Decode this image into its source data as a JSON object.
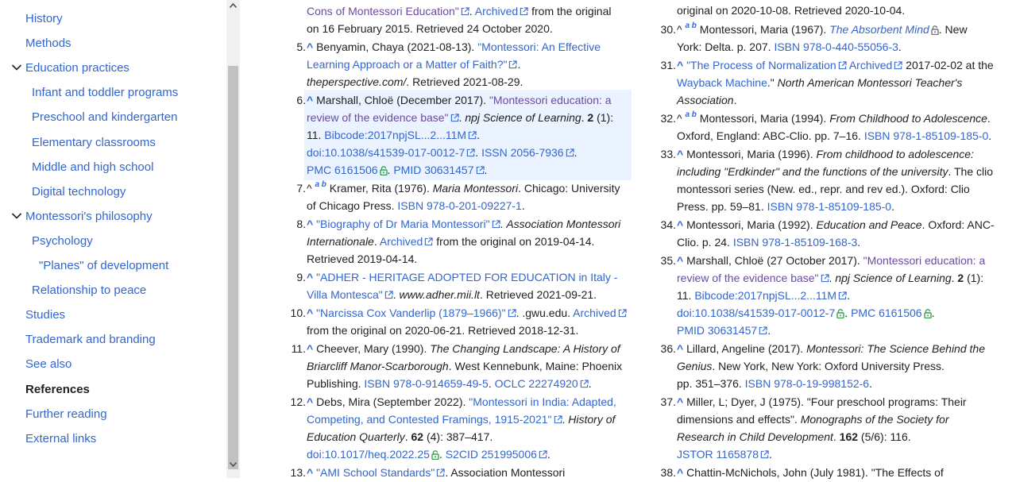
{
  "toc": {
    "items": [
      {
        "label": "History",
        "indent": 0
      },
      {
        "label": "Methods",
        "indent": 0
      },
      {
        "label": "Education practices",
        "indent": 0,
        "toggle": true
      },
      {
        "label": "Infant and toddler programs",
        "indent": 1
      },
      {
        "label": "Preschool and kindergarten",
        "indent": 1
      },
      {
        "label": "Elementary classrooms",
        "indent": 1
      },
      {
        "label": "Middle and high school",
        "indent": 1
      },
      {
        "label": "Digital technology",
        "indent": 1
      },
      {
        "label": "Montessori's philosophy",
        "indent": 0,
        "toggle": true
      },
      {
        "label": "Psychology",
        "indent": 1
      },
      {
        "label": "\"Planes\" of development",
        "indent": 2
      },
      {
        "label": "Relationship to peace",
        "indent": 1
      },
      {
        "label": "Studies",
        "indent": 0
      },
      {
        "label": "Trademark and branding",
        "indent": 0
      },
      {
        "label": "See also",
        "indent": 0
      },
      {
        "label": "References",
        "indent": 0,
        "active": true
      },
      {
        "label": "Further reading",
        "indent": 0
      },
      {
        "label": "External links",
        "indent": 0
      }
    ]
  },
  "refs_left": [
    {
      "num": "",
      "lines": [
        [
          [
            "vis|Cons of Montessori Education\""
          ],
          [
            "ext"
          ],
          [
            "txt|. "
          ],
          [
            "lnk|Archived"
          ],
          [
            "ext"
          ],
          [
            "txt| from the original"
          ]
        ],
        [
          [
            "txt|on 16 February 2015. Retrieved 24 October 2020."
          ]
        ]
      ]
    },
    {
      "num": "5.",
      "lines": [
        [
          [
            "caret|^ "
          ],
          [
            "txt|Benyamin, Chaya (2021-08-13). "
          ],
          [
            "lnk|\"Montessori: An Effective"
          ]
        ],
        [
          [
            "lnk|Learning Approach or a Matter of Faith?\""
          ],
          [
            "ext"
          ],
          [
            "txt|."
          ]
        ],
        [
          [
            "it|theperspective.com/"
          ],
          [
            "txt|. Retrieved 2021-08-29."
          ]
        ]
      ]
    },
    {
      "num": "6.",
      "hl": true,
      "lines": [
        [
          [
            "caret|^ "
          ],
          [
            "txt|Marshall, Chloë (December 2017). "
          ],
          [
            "vis|\"Montessori education: a"
          ]
        ],
        [
          [
            "vis|review of the evidence base\""
          ],
          [
            "ext"
          ],
          [
            "txt|. "
          ],
          [
            "it|npj Science of Learning"
          ],
          [
            "txt|. "
          ],
          [
            "b|2"
          ],
          [
            "txt| (1):"
          ]
        ],
        [
          [
            "txt|11. "
          ],
          [
            "lnk|Bibcode"
          ],
          [
            "lnk|:"
          ],
          [
            "lnk|2017npjSL...2...11M"
          ],
          [
            "ext"
          ],
          [
            "txt|."
          ]
        ],
        [
          [
            "lnk|doi"
          ],
          [
            "lnk|:"
          ],
          [
            "lnk|10.1038/s41539-017-0012-7"
          ],
          [
            "ext"
          ],
          [
            "txt|. "
          ],
          [
            "lnk|ISSN"
          ],
          [
            "txt| "
          ],
          [
            "lnk|2056-7936"
          ],
          [
            "ext"
          ],
          [
            "txt|."
          ]
        ],
        [
          [
            "lnk|PMC"
          ],
          [
            "txt| "
          ],
          [
            "lnk|6161506"
          ],
          [
            "lock"
          ],
          [
            "txt|. "
          ],
          [
            "lnk|PMID"
          ],
          [
            "txt| "
          ],
          [
            "lnk|30631457"
          ],
          [
            "ext"
          ],
          [
            "txt|."
          ]
        ]
      ]
    },
    {
      "num": "7.",
      "lines": [
        [
          [
            "txt|^ "
          ],
          [
            "sup|a b"
          ],
          [
            "txt| Kramer, Rita (1976). "
          ],
          [
            "it|Maria Montessori"
          ],
          [
            "txt|. Chicago: University"
          ]
        ],
        [
          [
            "txt|of Chicago Press. "
          ],
          [
            "lnk|ISBN"
          ],
          [
            "txt| "
          ],
          [
            "lnk|978-0-201-09227-1"
          ],
          [
            "txt|."
          ]
        ]
      ]
    },
    {
      "num": "8.",
      "lines": [
        [
          [
            "caret|^ "
          ],
          [
            "lnk|\"Biography of Dr Maria Montessori\""
          ],
          [
            "ext"
          ],
          [
            "txt|. "
          ],
          [
            "it|Association Montessori"
          ]
        ],
        [
          [
            "it|Internationale"
          ],
          [
            "txt|. "
          ],
          [
            "lnk|Archived"
          ],
          [
            "ext"
          ],
          [
            "txt| from the original on 2019-04-14."
          ]
        ],
        [
          [
            "txt|Retrieved 2019-04-14."
          ]
        ]
      ]
    },
    {
      "num": "9.",
      "lines": [
        [
          [
            "caret|^ "
          ],
          [
            "lnk|\"ADHER - HERITAGE ADOPTED FOR EDUCATION in Italy -"
          ]
        ],
        [
          [
            "lnk|Villa Montesca\""
          ],
          [
            "ext"
          ],
          [
            "txt|. "
          ],
          [
            "it|www.adher.mii.lt"
          ],
          [
            "txt|. Retrieved 2021-09-21."
          ]
        ]
      ]
    },
    {
      "num": "10.",
      "lines": [
        [
          [
            "caret|^ "
          ],
          [
            "lnk|\"Narcissa Cox Vanderlip (1879–1966)\""
          ],
          [
            "ext"
          ],
          [
            "txt|. .gwu.edu. "
          ],
          [
            "lnk|Archived"
          ],
          [
            "ext"
          ]
        ],
        [
          [
            "txt|from the original on 2020-06-21. Retrieved 2018-12-31."
          ]
        ]
      ]
    },
    {
      "num": "11.",
      "lines": [
        [
          [
            "caret|^ "
          ],
          [
            "txt|Cheever, Mary (1990). "
          ],
          [
            "it|The Changing Landscape: A History of"
          ]
        ],
        [
          [
            "it|Briarcliff Manor-Scarborough"
          ],
          [
            "txt|. West Kennebunk, Maine: Phoenix"
          ]
        ],
        [
          [
            "txt|Publishing. "
          ],
          [
            "lnk|ISBN"
          ],
          [
            "txt| "
          ],
          [
            "lnk|978-0-914659-49-5"
          ],
          [
            "txt|. "
          ],
          [
            "lnk|OCLC"
          ],
          [
            "txt| "
          ],
          [
            "lnk|22274920"
          ],
          [
            "ext"
          ],
          [
            "txt|."
          ]
        ]
      ]
    },
    {
      "num": "12.",
      "lines": [
        [
          [
            "caret|^ "
          ],
          [
            "txt|Debs, Mira (September 2022). "
          ],
          [
            "lnk|\"Montessori in India: Adapted,"
          ]
        ],
        [
          [
            "lnk|Competing, and Contested Framings, 1915-2021\""
          ],
          [
            "ext"
          ],
          [
            "txt|. "
          ],
          [
            "it|History of"
          ]
        ],
        [
          [
            "it|Education Quarterly"
          ],
          [
            "txt|. "
          ],
          [
            "b|62"
          ],
          [
            "txt| (4): 387–417."
          ]
        ],
        [
          [
            "lnk|doi"
          ],
          [
            "lnk|:"
          ],
          [
            "lnk|10.1017/heq.2022.25"
          ],
          [
            "lock"
          ],
          [
            "txt|. "
          ],
          [
            "lnk|S2CID"
          ],
          [
            "txt| "
          ],
          [
            "lnk|251995006"
          ],
          [
            "ext"
          ],
          [
            "txt|."
          ]
        ]
      ]
    },
    {
      "num": "13.",
      "lines": [
        [
          [
            "caret|^ "
          ],
          [
            "lnk|\"AMI School Standards\""
          ],
          [
            "ext"
          ],
          [
            "txt|. Association Montessori"
          ]
        ]
      ]
    }
  ],
  "refs_right": [
    {
      "num": "",
      "lines": [
        [
          [
            "txt|original on 2020-10-08. Retrieved 2020-10-04."
          ]
        ]
      ]
    },
    {
      "num": "30.",
      "lines": [
        [
          [
            "txt|^ "
          ],
          [
            "sup|a b"
          ],
          [
            "txt| Montessori, Maria (1967). "
          ],
          [
            "lnkit|The Absorbent Mind"
          ],
          [
            "lock"
          ],
          [
            "txt|. New"
          ]
        ],
        [
          [
            "txt|York: Delta. p. 207. "
          ],
          [
            "lnk|ISBN"
          ],
          [
            "txt| "
          ],
          [
            "lnk|978-0-440-55056-3"
          ],
          [
            "txt|."
          ]
        ]
      ]
    },
    {
      "num": "31.",
      "lines": [
        [
          [
            "caret|^ "
          ],
          [
            "lnk|\"The Process of Normalization"
          ],
          [
            "ext"
          ],
          [
            "txt| "
          ],
          [
            "lnk|Archived"
          ],
          [
            "ext"
          ],
          [
            "txt| 2017-02-02 at the"
          ]
        ],
        [
          [
            "lnk|Wayback Machine"
          ],
          [
            "txt|.\" "
          ],
          [
            "it|North American Montessori Teacher's"
          ]
        ],
        [
          [
            "it|Association"
          ],
          [
            "txt|."
          ]
        ]
      ]
    },
    {
      "num": "32.",
      "lines": [
        [
          [
            "txt|^ "
          ],
          [
            "sup|a b"
          ],
          [
            "txt| Montessori, Maria (1994). "
          ],
          [
            "it|From Childhood to Adolescence"
          ],
          [
            "txt|."
          ]
        ],
        [
          [
            "txt|Oxford, England: ABC-Clio. pp. 7–16. "
          ],
          [
            "lnk|ISBN"
          ],
          [
            "txt| "
          ],
          [
            "lnk|978-1-85109-185-0"
          ],
          [
            "txt|."
          ]
        ]
      ]
    },
    {
      "num": "33.",
      "lines": [
        [
          [
            "caret|^ "
          ],
          [
            "txt|Montessori, Maria (1996). "
          ],
          [
            "it|From childhood to adolescence:"
          ]
        ],
        [
          [
            "it|including \"Erdkinder\" and the functions of the university"
          ],
          [
            "txt|. The clio"
          ]
        ],
        [
          [
            "txt|montessori series (New. ed., repr. and rev ed.). Oxford: Clio"
          ]
        ],
        [
          [
            "txt|Press. pp. 59–81. "
          ],
          [
            "lnk|ISBN"
          ],
          [
            "txt| "
          ],
          [
            "lnk|978-1-85109-185-0"
          ],
          [
            "txt|."
          ]
        ]
      ]
    },
    {
      "num": "34.",
      "lines": [
        [
          [
            "caret|^ "
          ],
          [
            "txt|Montessori, Maria (1992). "
          ],
          [
            "it|Education and Peace"
          ],
          [
            "txt|. Oxford: ANC-"
          ]
        ],
        [
          [
            "txt|Clio. p. 24. "
          ],
          [
            "lnk|ISBN"
          ],
          [
            "txt| "
          ],
          [
            "lnk|978-1-85109-168-3"
          ],
          [
            "txt|."
          ]
        ]
      ]
    },
    {
      "num": "35.",
      "lines": [
        [
          [
            "caret|^ "
          ],
          [
            "txt|Marshall, Chloë (27 October 2017). "
          ],
          [
            "vis|\"Montessori education: a"
          ]
        ],
        [
          [
            "vis|review of the evidence base\""
          ],
          [
            "ext"
          ],
          [
            "txt|. "
          ],
          [
            "it|npj Science of Learning"
          ],
          [
            "txt|. "
          ],
          [
            "b|2"
          ],
          [
            "txt| (1):"
          ]
        ],
        [
          [
            "txt|11. "
          ],
          [
            "lnk|Bibcode"
          ],
          [
            "lnk|:"
          ],
          [
            "lnk|2017npjSL...2...11M"
          ],
          [
            "ext"
          ],
          [
            "txt|."
          ]
        ],
        [
          [
            "lnk|doi"
          ],
          [
            "lnk|:"
          ],
          [
            "lnk|10.1038/s41539-017-0012-7"
          ],
          [
            "lock"
          ],
          [
            "txt|. "
          ],
          [
            "lnk|PMC"
          ],
          [
            "txt| "
          ],
          [
            "lnk|6161506"
          ],
          [
            "lock"
          ],
          [
            "txt|."
          ]
        ],
        [
          [
            "lnk|PMID"
          ],
          [
            "txt| "
          ],
          [
            "lnk|30631457"
          ],
          [
            "ext"
          ],
          [
            "txt|."
          ]
        ]
      ]
    },
    {
      "num": "36.",
      "lines": [
        [
          [
            "caret|^ "
          ],
          [
            "txt|Lillard, Angeline (2017). "
          ],
          [
            "it|Montessori: The Science Behind the"
          ]
        ],
        [
          [
            "it|Genius"
          ],
          [
            "txt|. New York, New York: Oxford University Press."
          ]
        ],
        [
          [
            "txt|pp. 351–376. "
          ],
          [
            "lnk|ISBN"
          ],
          [
            "txt| "
          ],
          [
            "lnk|978-0-19-998152-6"
          ],
          [
            "txt|."
          ]
        ]
      ]
    },
    {
      "num": "37.",
      "lines": [
        [
          [
            "caret|^ "
          ],
          [
            "txt|Miller, L; Dyer, J (1975). \"Four preschool programs: Their"
          ]
        ],
        [
          [
            "txt|dimensions and effects\". "
          ],
          [
            "it|Monographs of the Society for"
          ]
        ],
        [
          [
            "it|Research in Child Development"
          ],
          [
            "txt|. "
          ],
          [
            "b|162"
          ],
          [
            "txt| (5/6): 116."
          ]
        ],
        [
          [
            "lnk|JSTOR"
          ],
          [
            "txt| "
          ],
          [
            "lnk|1165878"
          ],
          [
            "ext"
          ],
          [
            "txt|."
          ]
        ]
      ]
    },
    {
      "num": "38.",
      "lines": [
        [
          [
            "caret|^ "
          ],
          [
            "txt|Chattin-McNichols, John (July 1981). \"The Effects of"
          ]
        ]
      ]
    }
  ]
}
